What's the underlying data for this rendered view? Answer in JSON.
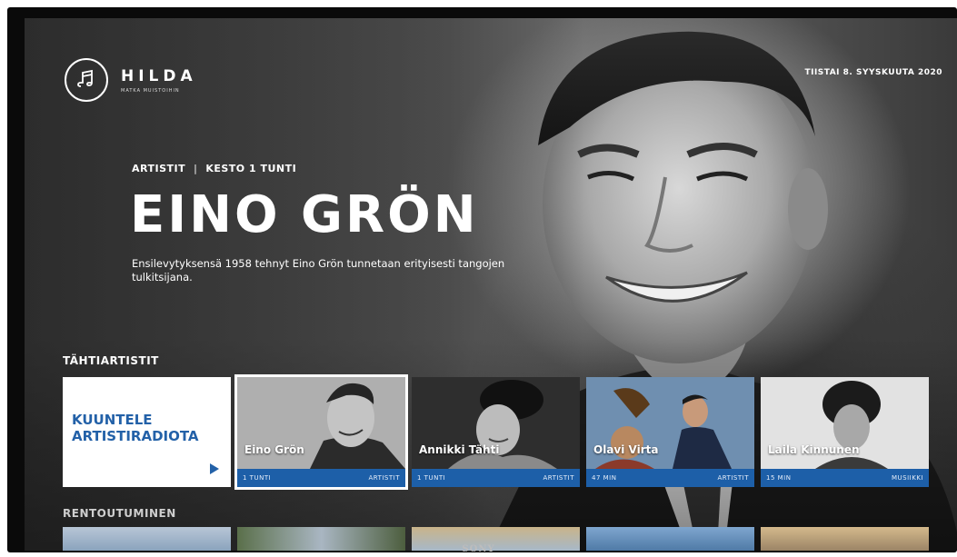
{
  "app": {
    "logo_name": "HILDA",
    "logo_subtitle": "MATKA MUISTOIHIN",
    "date": "TIISTAI 8. SYYSKUUTA 2020"
  },
  "hero": {
    "category": "ARTISTIT",
    "separator": "|",
    "duration": "KESTO 1 TUNTI",
    "title": "EINO GRÖN",
    "description": "Ensilevytyksensä 1958 tehnyt Eino Grön tunnetaan erityisesti tangojen tulkitsijana."
  },
  "rows": [
    {
      "title": "TÄHTIARTISTIT",
      "cta": {
        "line1": "KUUNTELE",
        "line2": "ARTISTIRADIOTA",
        "icon": "play-icon"
      },
      "tiles": [
        {
          "name": "Eino Grön",
          "duration": "1 TUNTI",
          "type": "ARTISTIT",
          "selected": true
        },
        {
          "name": "Annikki Tähti",
          "duration": "1 TUNTI",
          "type": "ARTISTIT",
          "selected": false
        },
        {
          "name": "Olavi Virta",
          "duration": "47 MIN",
          "type": "ARTISTIT",
          "selected": false
        },
        {
          "name": "Laila Kinnunen",
          "duration": "15 MIN",
          "type": "MUSIIKKI",
          "selected": false
        }
      ]
    },
    {
      "title": "RENTOUTUMINEN"
    }
  ],
  "tv": {
    "brand": "SONY"
  },
  "colors": {
    "accent": "#1d5fa8",
    "cta_text": "#2361a8",
    "tile_bg": "#ffffff"
  }
}
